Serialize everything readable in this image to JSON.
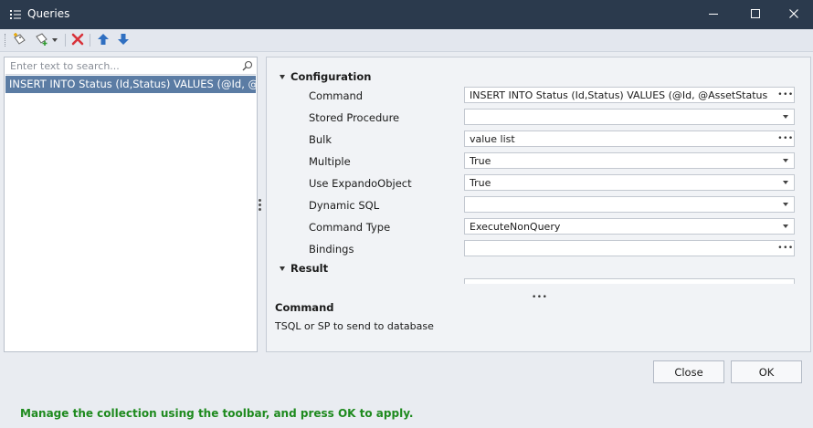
{
  "window": {
    "title": "Queries",
    "controls": [
      "minimize-icon",
      "maximize-icon",
      "close-icon"
    ]
  },
  "toolbar": {
    "icons": [
      "add-query-icon",
      "add-from-template-icon",
      "delete-icon",
      "move-up-icon",
      "move-down-icon"
    ]
  },
  "search": {
    "placeholder": "Enter text to search..."
  },
  "list": {
    "items": [
      {
        "label": "INSERT INTO Status (Id,Status) VALUES (@Id, @Ass",
        "selected": true
      }
    ]
  },
  "properties": {
    "categories": [
      {
        "label": "Configuration"
      },
      {
        "label": "Result"
      }
    ],
    "rows": [
      {
        "name": "Command",
        "value": "INSERT INTO Status (Id,Status) VALUES (@Id, @AssetStatus )",
        "editor": "ellipsis"
      },
      {
        "name": "Stored Procedure",
        "value": "",
        "editor": "dropdown"
      },
      {
        "name": "Bulk",
        "value": "value list",
        "editor": "ellipsis"
      },
      {
        "name": "Multiple",
        "value": "True",
        "editor": "dropdown"
      },
      {
        "name": "Use ExpandoObject",
        "value": "True",
        "editor": "dropdown"
      },
      {
        "name": "Dynamic SQL",
        "value": "",
        "editor": "dropdown"
      },
      {
        "name": "Command Type",
        "value": "ExecuteNonQuery",
        "editor": "dropdown"
      },
      {
        "name": "Bindings",
        "value": "",
        "editor": "ellipsis"
      }
    ]
  },
  "description": {
    "title": "Command",
    "text": "TSQL or SP to send to database"
  },
  "buttons": {
    "close": "Close",
    "ok": "OK"
  },
  "status": {
    "text": "Manage the collection using the toolbar, and press OK to apply.",
    "color": "#1e8a1e"
  },
  "colors": {
    "titlebar": "#2b3a4d",
    "selection": "#5b7ca4"
  }
}
